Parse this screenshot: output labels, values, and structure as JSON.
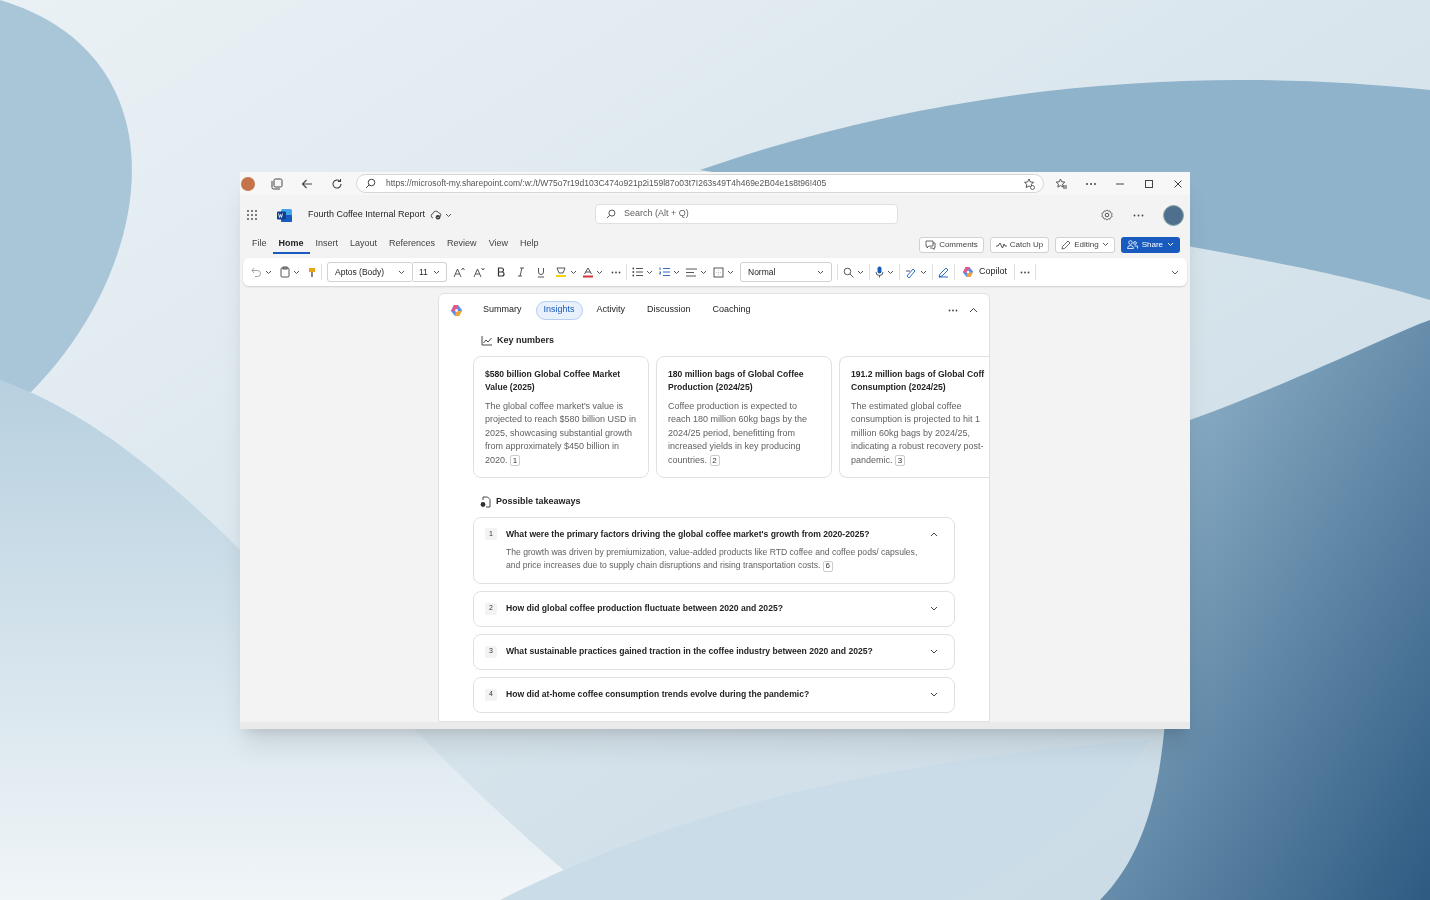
{
  "browser": {
    "url": "https://microsoft-my.sharepoint.com/:w:/t/W75o7r19d103C474o921p2i159l87o03t7I263s49T4h469e2B04e1s8t96!405"
  },
  "app": {
    "document_title": "Fourth Coffee Internal Report",
    "search": {
      "placeholder": "Search (Alt + Q)"
    }
  },
  "menu_tabs": [
    {
      "label": "File",
      "selected": false
    },
    {
      "label": "Home",
      "selected": true
    },
    {
      "label": "Insert",
      "selected": false
    },
    {
      "label": "Layout",
      "selected": false
    },
    {
      "label": "References",
      "selected": false
    },
    {
      "label": "Review",
      "selected": false
    },
    {
      "label": "View",
      "selected": false
    },
    {
      "label": "Help",
      "selected": false
    }
  ],
  "header_buttons": [
    {
      "kind": "comments",
      "label": "Comments"
    },
    {
      "kind": "catchup",
      "label": "Catch Up"
    },
    {
      "kind": "editing",
      "label": "Editing"
    },
    {
      "kind": "share",
      "label": "Share"
    }
  ],
  "ribbon": {
    "font": "Aptos (Body)",
    "size": "11",
    "style": "Normal",
    "copilot": "Copilot"
  },
  "panel": {
    "tabs": [
      {
        "label": "Summary",
        "selected": false
      },
      {
        "label": "Insights",
        "selected": true
      },
      {
        "label": "Activity",
        "selected": false
      },
      {
        "label": "Discussion",
        "selected": false
      },
      {
        "label": "Coaching",
        "selected": false
      }
    ],
    "key_numbers": {
      "heading": "Key numbers",
      "cards": [
        {
          "title": "$580 billion Global Coffee Market Value (2025)",
          "body": "The global coffee market's value is projected to reach $580 billion USD in 2025, showcasing substantial growth from approximately $450 billion in 2020.",
          "ref": "1"
        },
        {
          "title": "180 million bags of Global Coffee Production (2024/25)",
          "body": "Coffee production is expected to reach 180 million 60kg bags by the 2024/25 period, benefitting from increased yields in key producing countries.",
          "ref": "2"
        },
        {
          "title": "191.2 million bags of Global Coff Consumption (2024/25)",
          "body": "The estimated global coffee consumption is projected to hit 1 million 60kg bags by 2024/25, indicating a robust recovery post- pandemic.",
          "ref": "3"
        }
      ]
    },
    "takeaways": {
      "heading": "Possible takeaways",
      "items": [
        {
          "number": "1",
          "question": "What were the primary factors driving the global coffee market's growth from 2020-2025?",
          "expanded": true,
          "answer": "The growth was driven by premiumization, value-added products like RTD coffee and coffee pods/ capsules, and price increases due to supply chain disruptions and rising transportation costs.",
          "ref": "6"
        },
        {
          "number": "2",
          "question": "How did global coffee production fluctuate between 2020 and 2025?",
          "expanded": false
        },
        {
          "number": "3",
          "question": "What sustainable practices gained traction in the coffee industry between 2020 and 2025?",
          "expanded": false
        },
        {
          "number": "4",
          "question": "How did at-home coffee consumption trends evolve during the pandemic?",
          "expanded": false
        }
      ]
    }
  }
}
